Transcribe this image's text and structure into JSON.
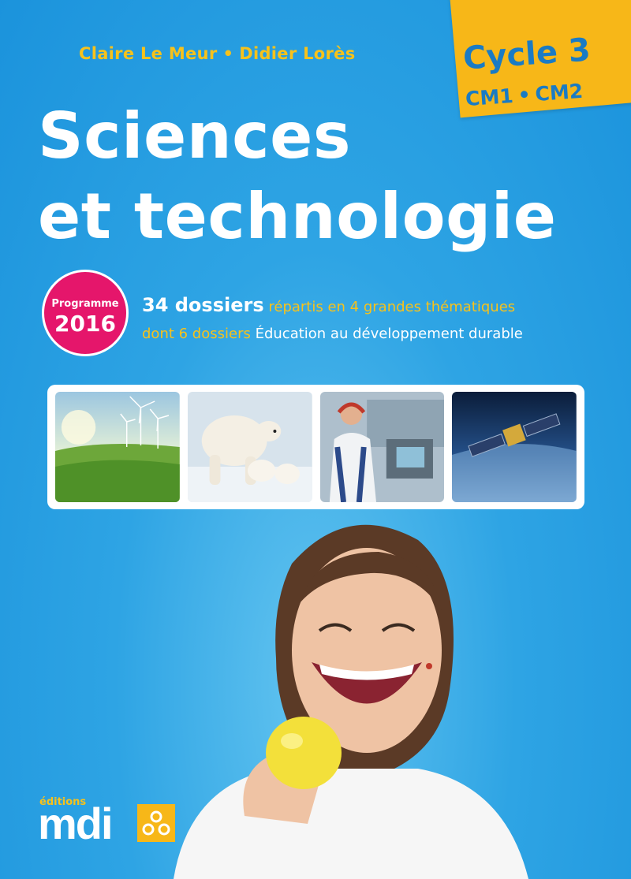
{
  "authors": {
    "first": "Claire Le Meur",
    "separator": "•",
    "second": "Didier Lorès"
  },
  "cycle": {
    "title": "Cycle 3",
    "level1": "CM1",
    "separator": "•",
    "level2": "CM2"
  },
  "title": {
    "line1": "Sciences",
    "line2": "et technologie"
  },
  "badge": {
    "label": "Programme",
    "year": "2016"
  },
  "info": {
    "line1_highlight": "34 dossiers",
    "line1_rest": "répartis en 4 grandes thématiques",
    "line2_highlight": "dont 6 dossiers",
    "line2_rest": "Éducation au développement durable"
  },
  "publisher": {
    "small": "éditions",
    "name": "mdi"
  },
  "colors": {
    "background": "#1b93dc",
    "accent_yellow": "#f7b718",
    "badge_pink": "#e5166b",
    "title_white": "#ffffff"
  },
  "photos": [
    "wind-turbines-field",
    "polar-bears",
    "industrial-operator",
    "satellite-over-earth"
  ]
}
